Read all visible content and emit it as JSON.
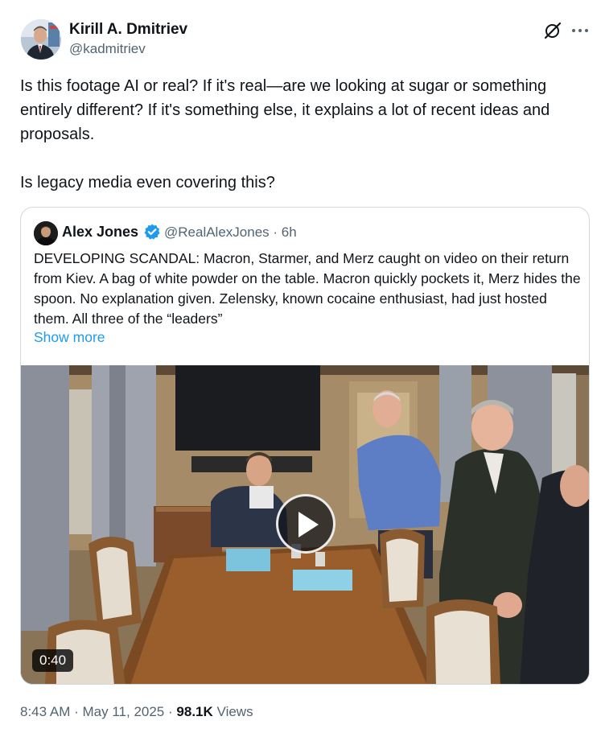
{
  "author": {
    "name": "Kirill A. Dmitriev",
    "handle": "@kadmitriev",
    "avatar_icon": "person-avatar"
  },
  "header_icons": [
    "grok-icon",
    "more-icon"
  ],
  "post": {
    "text": "Is this footage AI or real? If it's real—are we looking at sugar or something entirely different? If it's something else, it explains a lot of recent ideas and proposals.\n\nIs legacy media even covering this?"
  },
  "quoted_post": {
    "name": "Alex Jones",
    "handle_time": "@RealAlexJones · 6h",
    "verified_icon": "verified-badge-icon",
    "text": "DEVELOPING SCANDAL: Macron, Starmer, and Merz caught on video on their return from Kiev. A bag of white powder on the table. Macron quickly pockets it, Merz hides the spoon. No explanation given. Zelensky, known cocaine enthusiast, had just hosted them. All three of the “leaders”",
    "show_more": "Show more",
    "video": {
      "duration": "0:40",
      "play_icon": "play-icon"
    }
  },
  "meta": {
    "time": "8:43 AM",
    "date": "May 11, 2025",
    "separator": "·",
    "views_count": "98.1K",
    "views_label": "Views"
  },
  "colors": {
    "text": "#0f1419",
    "secondary": "#536471",
    "link": "#1d9bf0",
    "border": "#cfd9de"
  }
}
